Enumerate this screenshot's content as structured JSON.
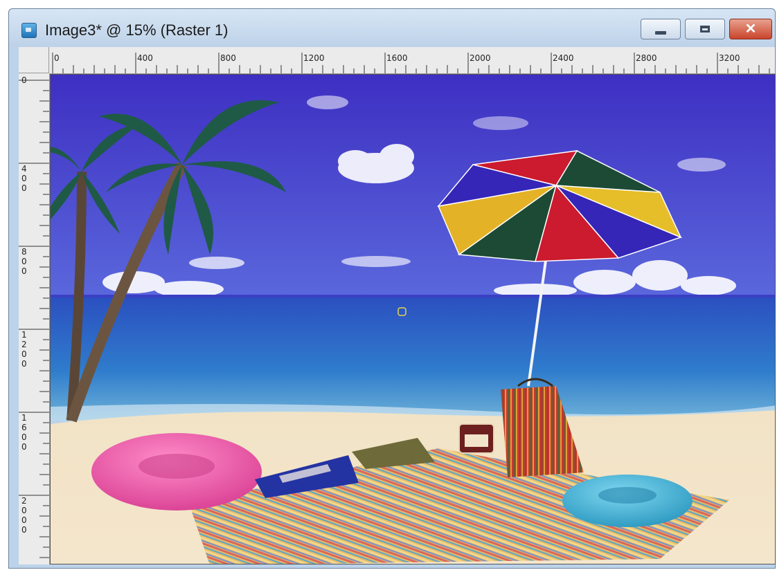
{
  "window": {
    "title": "Image3* @  15% (Raster 1)",
    "buttons": {
      "minimize": "minimize",
      "maximize": "maximize",
      "close": "close"
    },
    "close_glyph": "✕"
  },
  "ruler": {
    "horizontal_labels": [
      "0",
      "400",
      "800",
      "1200",
      "1600",
      "2000",
      "2400",
      "2800",
      "3200"
    ],
    "vertical_labels": [
      "0",
      "400",
      "800",
      "1200",
      "1600",
      "2000"
    ]
  },
  "canvas": {
    "zoom": "15%",
    "layer": "Raster 1",
    "image_description_icon": "photo-icon",
    "colors": {
      "sky": "#4b3fd0",
      "sea": "#2b73c8",
      "sand": "#f1e2c4",
      "pink_float": "#ec5aa8",
      "blue_float": "#3fb2d6"
    }
  }
}
